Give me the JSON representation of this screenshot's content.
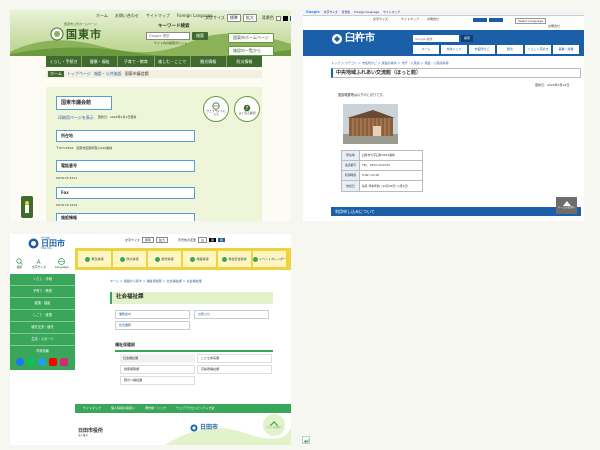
{
  "kunisaki": {
    "utility_links": [
      "ホーム",
      "お問い合わせ",
      "サイトマップ",
      "Foreign Language"
    ],
    "text_size_label": "文字サイズ",
    "text_sizes": [
      "標準",
      "拡大"
    ],
    "bg_color_label": "背景色",
    "logo_caption": "国東市公式ホームページ",
    "logo_text": "国東市",
    "keyword_search_label": "キーワード検索",
    "search_placeholder": "Google 提供",
    "search_button": "検索",
    "search_tips_link": "サイト内の検索のヒント",
    "quick_links": [
      "国東市ホームページ",
      "施設の一覧から"
    ],
    "nav": [
      "くらし・手続き",
      "健康・福祉",
      "子育て・教育",
      "楽しむ・ここで",
      "観光情報",
      "防災情報"
    ],
    "breadcrumb": [
      "ホーム",
      "トップページ",
      "施設・公共施設",
      "国東市議会館"
    ],
    "page_title": "国東市議会館",
    "print_link": "印刷用ページを表示",
    "updated": "更新日：2024年4月1日更新",
    "round_buttons": [
      "ウェブサイトに入る",
      "よく見る質問"
    ],
    "sections": [
      "所在地",
      "電話番号",
      "Fax",
      "施設情報"
    ],
    "address": "〒873-0503　国東市国東町鶴川149番地",
    "phone": "0978-72-5111",
    "fax": "0978-72-1519"
  },
  "usuki": {
    "google_label": "Google",
    "google_links": [
      "文字サイズ",
      "背景色",
      "Foreign Language",
      "サイトマップ"
    ],
    "lang_select": "Select Language",
    "logo_text": "臼杵市",
    "search_placeholder": "Google 提供",
    "search_button": "検索",
    "top_links": [
      "文字サイズ",
      "サイトマップ",
      "お問合せ"
    ],
    "nav": [
      "ホーム",
      "市政トップ",
      "市役所のご",
      "観光",
      "くらしと手続き",
      "事業・産業"
    ],
    "breadcrumb": "トップ ＞ カテゴリ ＞ 市役所のご ＞ 施設の案内 ＞ 市庁・公民館 ＞ 施設・公民館情報",
    "page_title": "中央地域ふれあい交流館（ほっと館）",
    "updated": "更新日：2024年3月14日",
    "intro": "施設概要等は以下のとおりです。",
    "table": [
      {
        "label": "所在地",
        "value": "臼杵市大字臼杵XXXX番地"
      },
      {
        "label": "電話番号",
        "value": "TEL：0972-XX-XXXX"
      },
      {
        "label": "利用時間",
        "value": "9:00～22:00"
      },
      {
        "label": "休館日",
        "value": "毎月 年末年始（12月29日～1月3日）"
      }
    ],
    "bar_text": "利用申し込みについて",
    "page_top": "ページの先頭へ"
  },
  "hita": {
    "logo_caption": "大分県",
    "logo_text": "日田市",
    "logo_sub": "Hita City",
    "side_icons": [
      "検索",
      "文字サイズ",
      "Language"
    ],
    "side_nav": [
      "くらし・手続",
      "子育て・教育",
      "健康・福祉",
      "しごと・産業",
      "観光交流・観光",
      "生活・スポーツ",
      "市政情報"
    ],
    "top_controls": [
      "文字サイズ",
      "標準",
      "拡大",
      "背景色の変更",
      "白",
      "黒",
      "青"
    ],
    "tiles": [
      "緊急情報",
      "防災情報",
      "観光情報",
      "施設情報",
      "移住定住情報",
      "イベントカレンダー"
    ],
    "breadcrumb": "ホーム ＞ 組織から探す ＞ 福祉保健部 ＞ 社会福祉課 ＞ 社会福祉課",
    "page_title": "社会福祉課",
    "section_links": [
      "業務案内",
      "お知らせ",
      "担当業務"
    ],
    "subsection_title": "福祉保健部",
    "list": [
      "社会福祉課",
      "こども未来課",
      "健康保険課",
      "高齢者福祉課",
      "障がい福祉課"
    ],
    "footer_links": [
      "サイトマップ",
      "個人情報の取扱い",
      "著作権・リンク",
      "ウェブアクセシビリティ方針"
    ],
    "office_name": "日田市役所",
    "office_sub": "法人番号",
    "page_top": "ページの先頭へ"
  },
  "colors": {
    "kunisaki_green": "#8db35a",
    "kunisaki_dark": "#3f6b2f",
    "usuki_blue": "#1b5fa8",
    "hita_green": "#3aa65a",
    "hita_yellow": "#f2d23c"
  },
  "broken_image_icon": "broken-image-icon"
}
